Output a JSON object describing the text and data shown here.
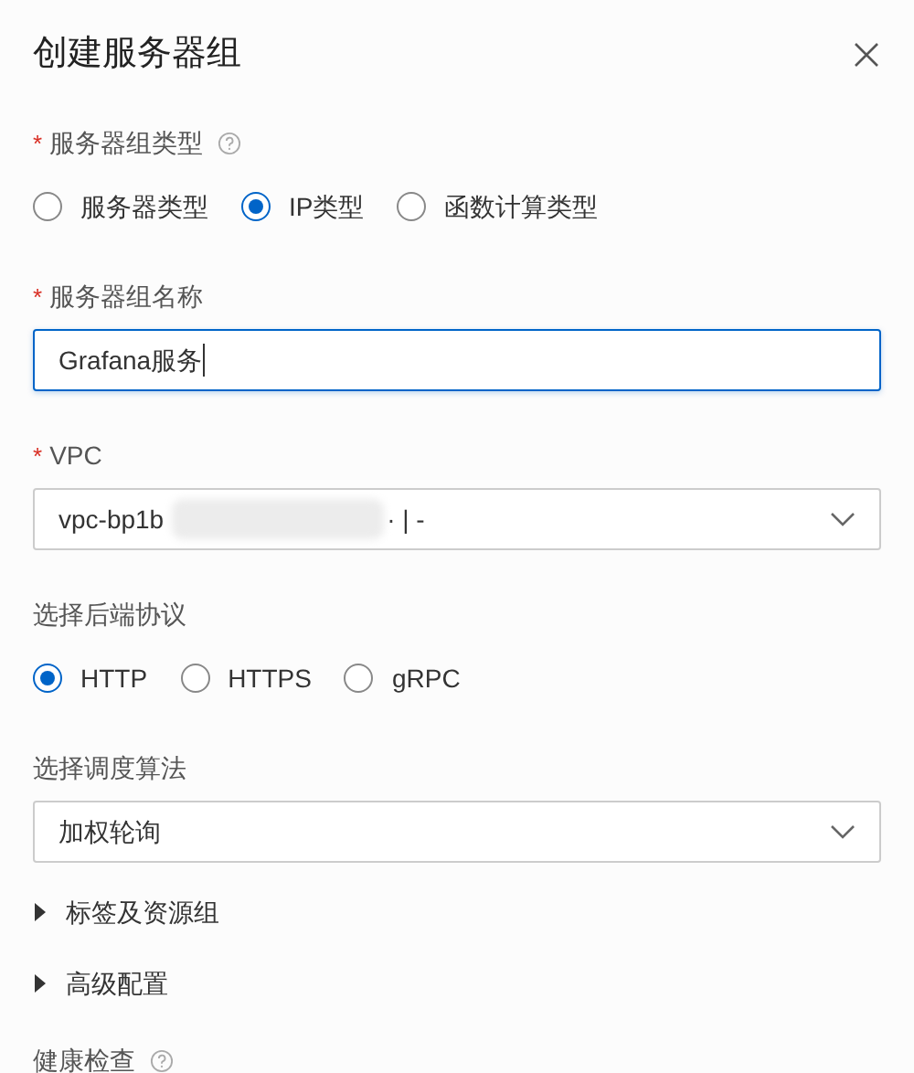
{
  "title": "创建服务器组",
  "sections": [
    {
      "kind": "radio",
      "mark": "*",
      "label": "服务器组类型",
      "help": true,
      "options": [
        {
          "label": "服务器类型",
          "selected": false
        },
        {
          "label": "IP类型",
          "selected": true
        },
        {
          "label": "函数计算类型",
          "selected": false
        }
      ]
    },
    {
      "kind": "input",
      "mark": "*",
      "label": "服务器组名称",
      "value": "Grafana服务",
      "focused": true
    },
    {
      "kind": "select",
      "mark": "*",
      "label": "VPC",
      "value": "vpc-bp1b",
      "redacted": true,
      "value_suffix": "· | -"
    },
    {
      "kind": "radio",
      "label": "选择后端协议",
      "options": [
        {
          "label": "HTTP",
          "selected": true
        },
        {
          "label": "HTTPS",
          "selected": false
        },
        {
          "label": "gRPC",
          "selected": false
        }
      ]
    },
    {
      "kind": "select",
      "label": "选择调度算法",
      "value": "加权轮询"
    },
    {
      "kind": "collapse",
      "label": "标签及资源组",
      "expanded": false
    },
    {
      "kind": "collapse",
      "label": "高级配置",
      "expanded": false
    },
    {
      "kind": "heading",
      "label": "健康检查",
      "help": true
    }
  ]
}
